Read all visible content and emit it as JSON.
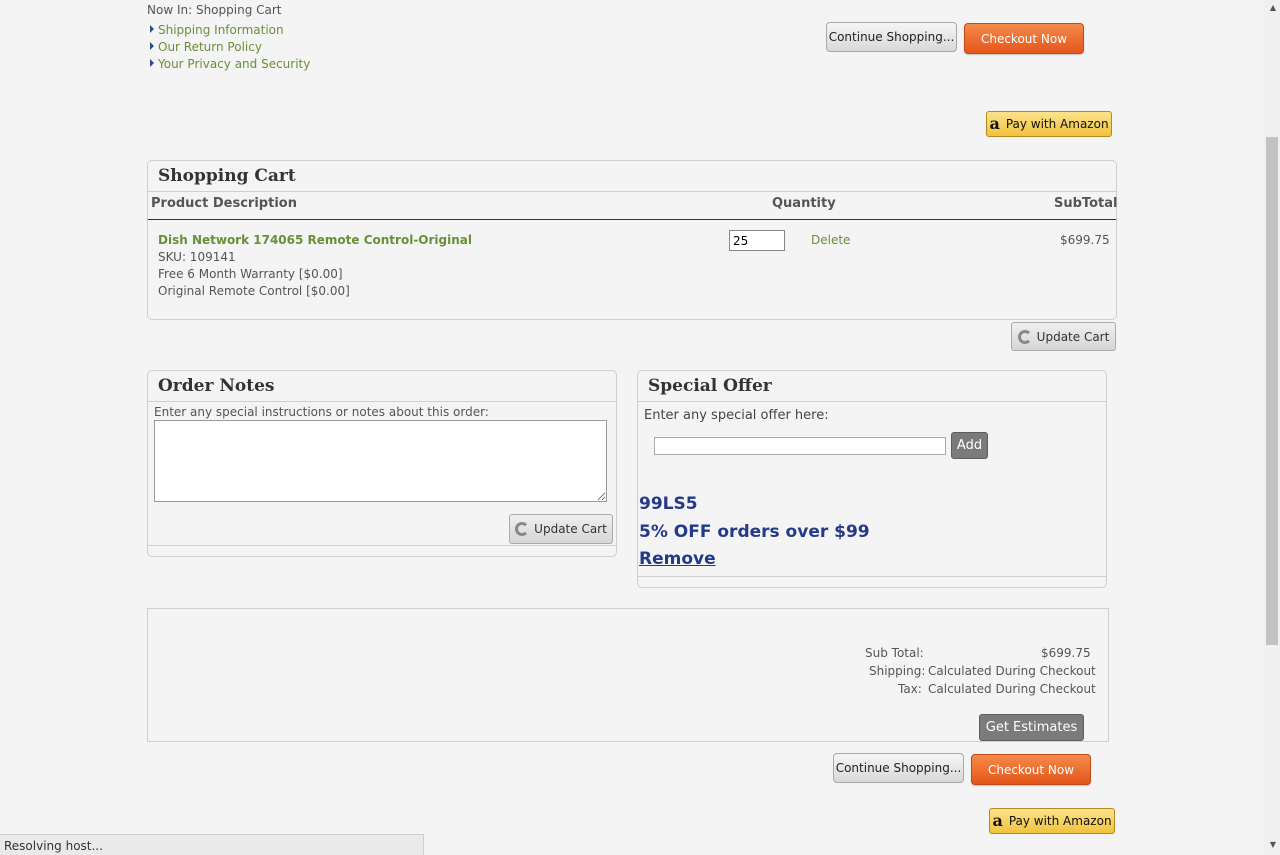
{
  "breadcrumb": "Now In: Shopping Cart",
  "info_links": [
    "Shipping Information",
    "Our Return Policy",
    "Your Privacy and Security"
  ],
  "top_buttons": {
    "continue": "Continue Shopping...",
    "checkout": "Checkout Now",
    "amazon": "Pay with Amazon"
  },
  "cart": {
    "title": "Shopping Cart",
    "columns": {
      "product": "Product Description",
      "quantity": "Quantity",
      "subtotal": "SubTotal"
    },
    "item": {
      "name": "Dish Network 174065 Remote Control-Original",
      "sku": "SKU: 109141",
      "options": [
        "Free 6 Month Warranty [$0.00]",
        "Original Remote Control [$0.00]"
      ],
      "quantity": "25",
      "delete": "Delete",
      "subtotal": "$699.75"
    },
    "update_button": "Update Cart"
  },
  "order_notes": {
    "title": "Order Notes",
    "instructions": "Enter any special instructions or notes about this order:",
    "update_button": "Update Cart"
  },
  "special_offer": {
    "title": "Special Offer",
    "prompt": "Enter any special offer here:",
    "add_button": "Add",
    "code": "99LS5",
    "description": "5% OFF orders over $99",
    "remove": "Remove"
  },
  "totals": {
    "sub_total_label": "Sub Total:",
    "sub_total_value": "$699.75",
    "shipping_label": "Shipping:",
    "shipping_value": "Calculated During Checkout",
    "tax_label": "Tax:",
    "tax_value": "Calculated During Checkout",
    "estimates_button": "Get Estimates"
  },
  "bottom_buttons": {
    "continue": "Continue Shopping...",
    "checkout": "Checkout Now",
    "amazon": "Pay with Amazon"
  },
  "status_bar": "Resolving host..."
}
